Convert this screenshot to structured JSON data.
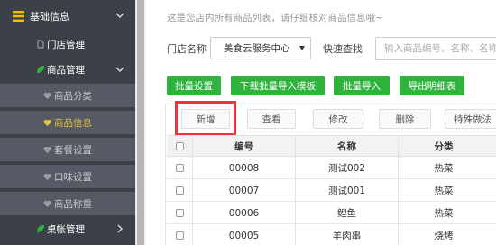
{
  "sidebar": {
    "group_basic": "基础信息",
    "store_mgmt": "门店管理",
    "goods_mgmt": "商品管理",
    "leaf_items": [
      "商品分类",
      "商品信息",
      "套餐设置",
      "口味设置",
      "商品称重"
    ],
    "table_mgmt": "桌帐管理"
  },
  "notice": "这是您店内所有商品列表，请仔细核对商品信息哦~",
  "filter": {
    "store_label": "门店名称",
    "store_value": "美食云服务中心",
    "search_label": "快速查找",
    "search_placeholder": "输入商品编号、名称、名称简"
  },
  "green_buttons": [
    "批量设置",
    "下载批量导入模板",
    "批量导入",
    "导出明细表"
  ],
  "toolbar": [
    "新增",
    "查看",
    "修改",
    "删除",
    "特殊做法"
  ],
  "table": {
    "headers": [
      "编号",
      "名称",
      "分类"
    ],
    "rows": [
      [
        "00008",
        "测试002",
        "热菜"
      ],
      [
        "00007",
        "测试001",
        "热菜"
      ],
      [
        "00006",
        "鲤鱼",
        "热菜"
      ],
      [
        "00005",
        "羊肉串",
        "烧烤"
      ]
    ]
  },
  "colors": {
    "sidebar_bg": "#3c4049",
    "sidebar_leaf_bg": "#565a65",
    "active": "#e8c23a",
    "green": "#2eb33d",
    "highlight": "#e53935"
  }
}
